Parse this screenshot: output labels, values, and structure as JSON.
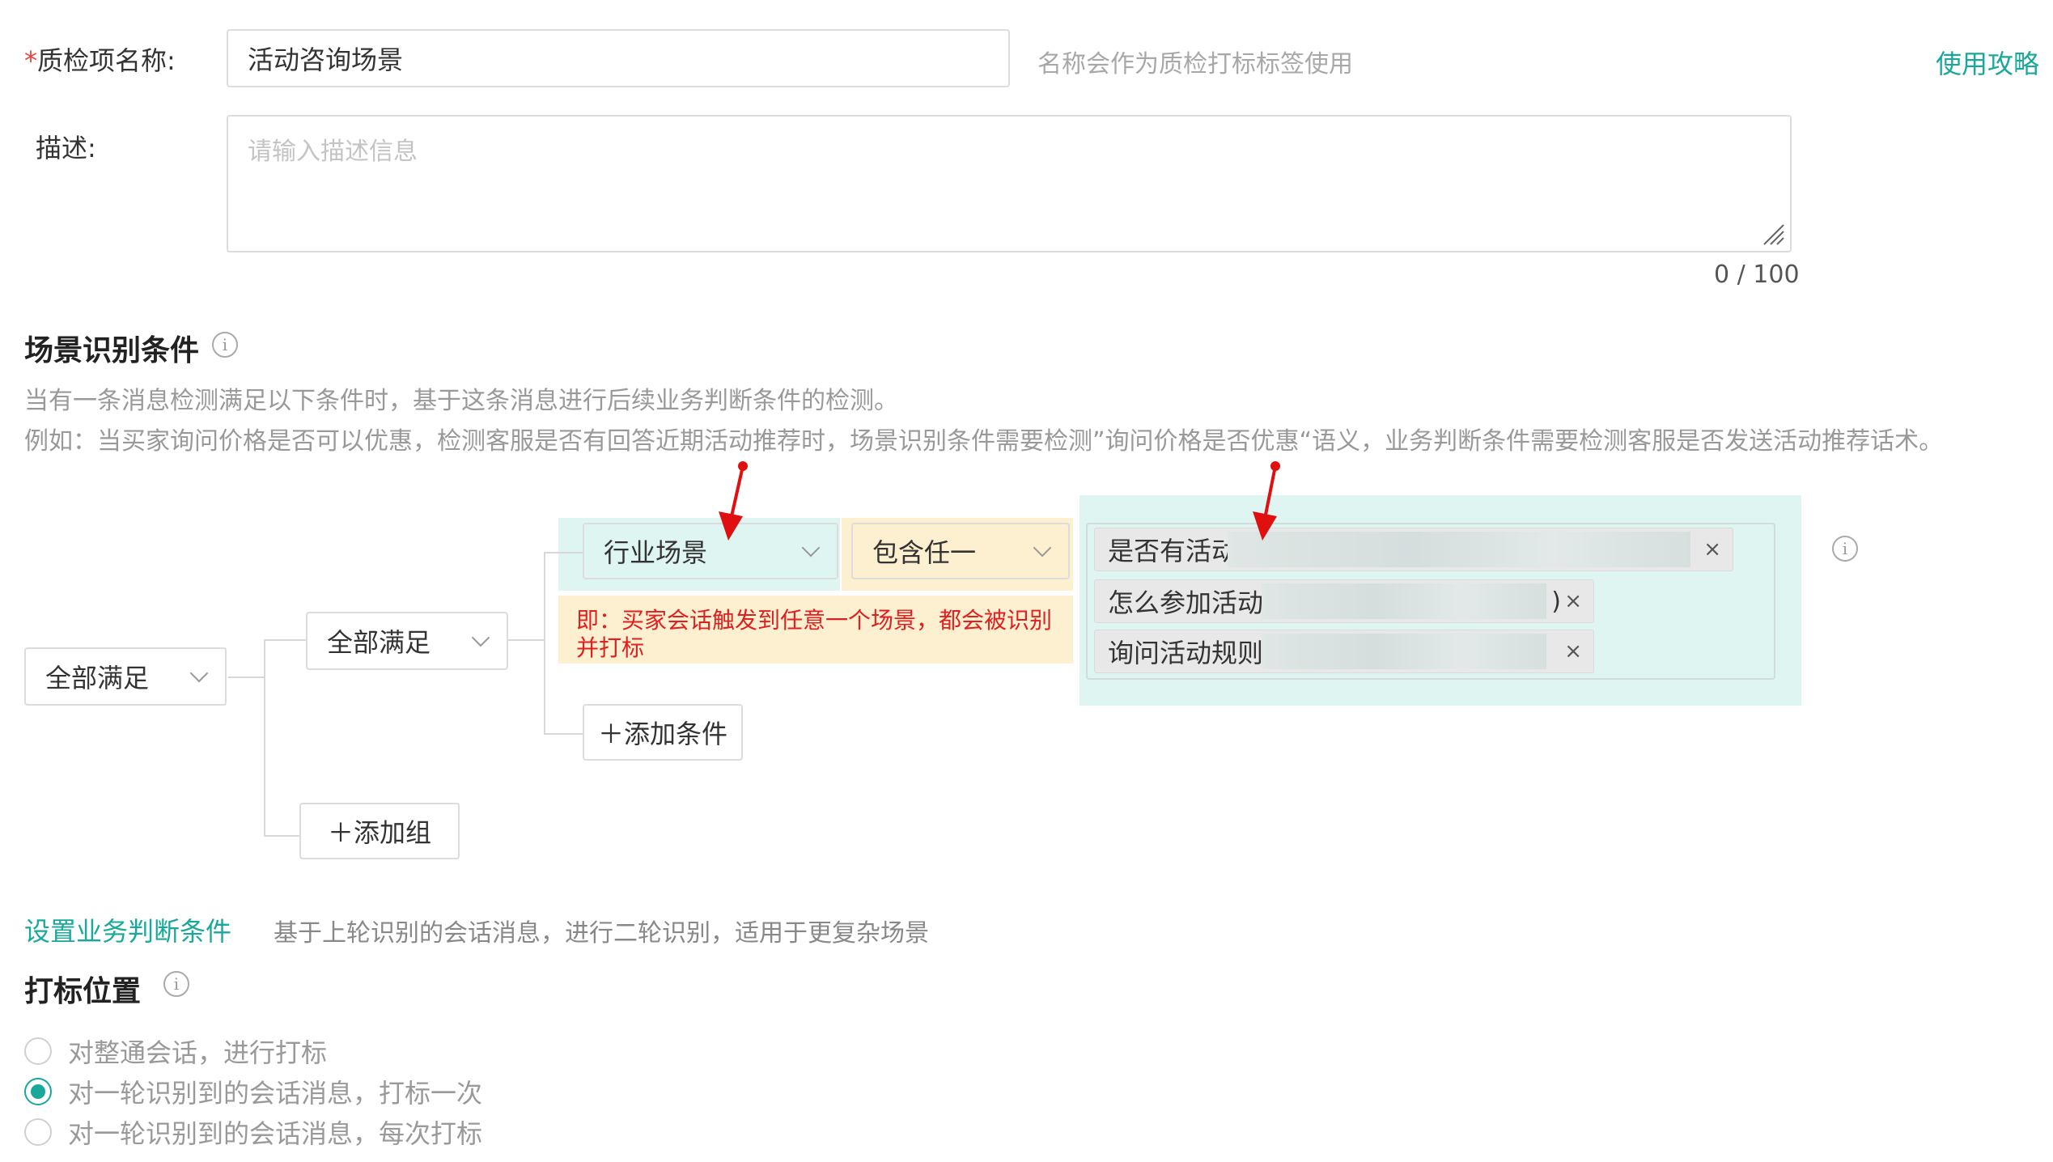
{
  "form": {
    "name_required_mark": "*",
    "name_label": "质检项名称:",
    "name_value": "活动咨询场景",
    "name_hint": "名称会作为质检打标标签使用",
    "guide_link": "使用攻略",
    "desc_label": "描述:",
    "desc_placeholder": "请输入描述信息",
    "desc_counter": "0 / 100"
  },
  "scene": {
    "title": "场景识别条件",
    "desc_line1": "当有一条消息检测满足以下条件时，基于这条消息进行后续业务判断条件的检测。",
    "desc_line2": "例如：当买家询问价格是否可以优惠，检测客服是否有回答近期活动推荐时，场景识别条件需要检测”询问价格是否优惠“语义，业务判断条件需要检测客服是否发送活动推荐话术。",
    "root_select": "全部满足",
    "group_select": "全部满足",
    "condition_field": "行业场景",
    "condition_operator": "包含任一",
    "annotation": "即：买家会话触发到任意一个场景，都会被识别并打标",
    "values": [
      {
        "label": "是否有活动",
        "close": "×"
      },
      {
        "label": "怎么参加活动",
        "close": "×"
      },
      {
        "label": "询问活动规则",
        "close": "×"
      }
    ],
    "tag_suffix": ")",
    "add_condition": "＋添加条件",
    "add_group": "＋添加组"
  },
  "business": {
    "link": "设置业务判断条件",
    "desc": "基于上轮识别的会话消息，进行二轮识别，适用于更复杂场景"
  },
  "marking": {
    "title": "打标位置",
    "options": [
      {
        "label": "对整通会话，进行打标",
        "selected": false
      },
      {
        "label": "对一轮识别到的会话消息，打标一次",
        "selected": true
      },
      {
        "label": "对一轮识别到的会话消息，每次打标",
        "selected": false
      }
    ]
  },
  "colors": {
    "accent": "#19a89a",
    "annotation_red": "#e02020",
    "highlight_teal": "#dff5f2",
    "highlight_yellow": "#fdf0d0"
  },
  "icons": {
    "info": "info-circle-icon",
    "chevron": "chevron-down-icon",
    "close": "close-icon",
    "arrow": "red-arrow-icon"
  }
}
